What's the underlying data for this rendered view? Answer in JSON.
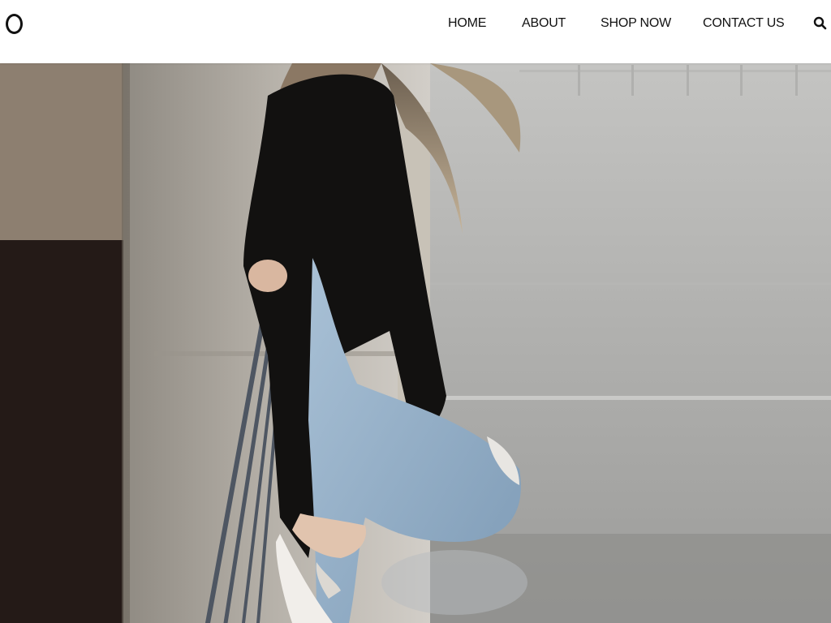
{
  "header": {
    "logo_label": "O",
    "nav": [
      {
        "label": "HOME"
      },
      {
        "label": "ABOUT"
      },
      {
        "label": "SHOP NOW"
      },
      {
        "label": "CONTACT US"
      }
    ],
    "search_icon": "search-icon"
  },
  "colors": {
    "nav_text": "#111111",
    "header_bg": "#ffffff"
  }
}
